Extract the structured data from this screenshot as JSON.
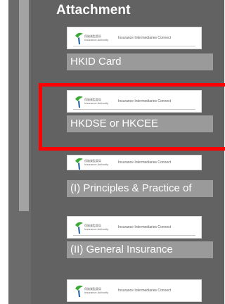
{
  "section": {
    "title": "Attachment"
  },
  "thumbnail": {
    "logo_text_cn": "保險業監管局",
    "logo_text_en": "Insurance Authority",
    "header_text": "Insurance Intermediaries Connect"
  },
  "attachments": [
    {
      "label": "HKID Card"
    },
    {
      "label": "HKDSE or HKCEE"
    },
    {
      "label": "(I) Principles & Practice of"
    },
    {
      "label": "(II) General Insurance"
    },
    {
      "label": ""
    }
  ],
  "colors": {
    "panel_bg": "#626262",
    "name_box_bg": "#9a9a9a",
    "highlight": "#ff0000",
    "logo_green": "#3aa935",
    "logo_blue": "#1c5ea8"
  }
}
